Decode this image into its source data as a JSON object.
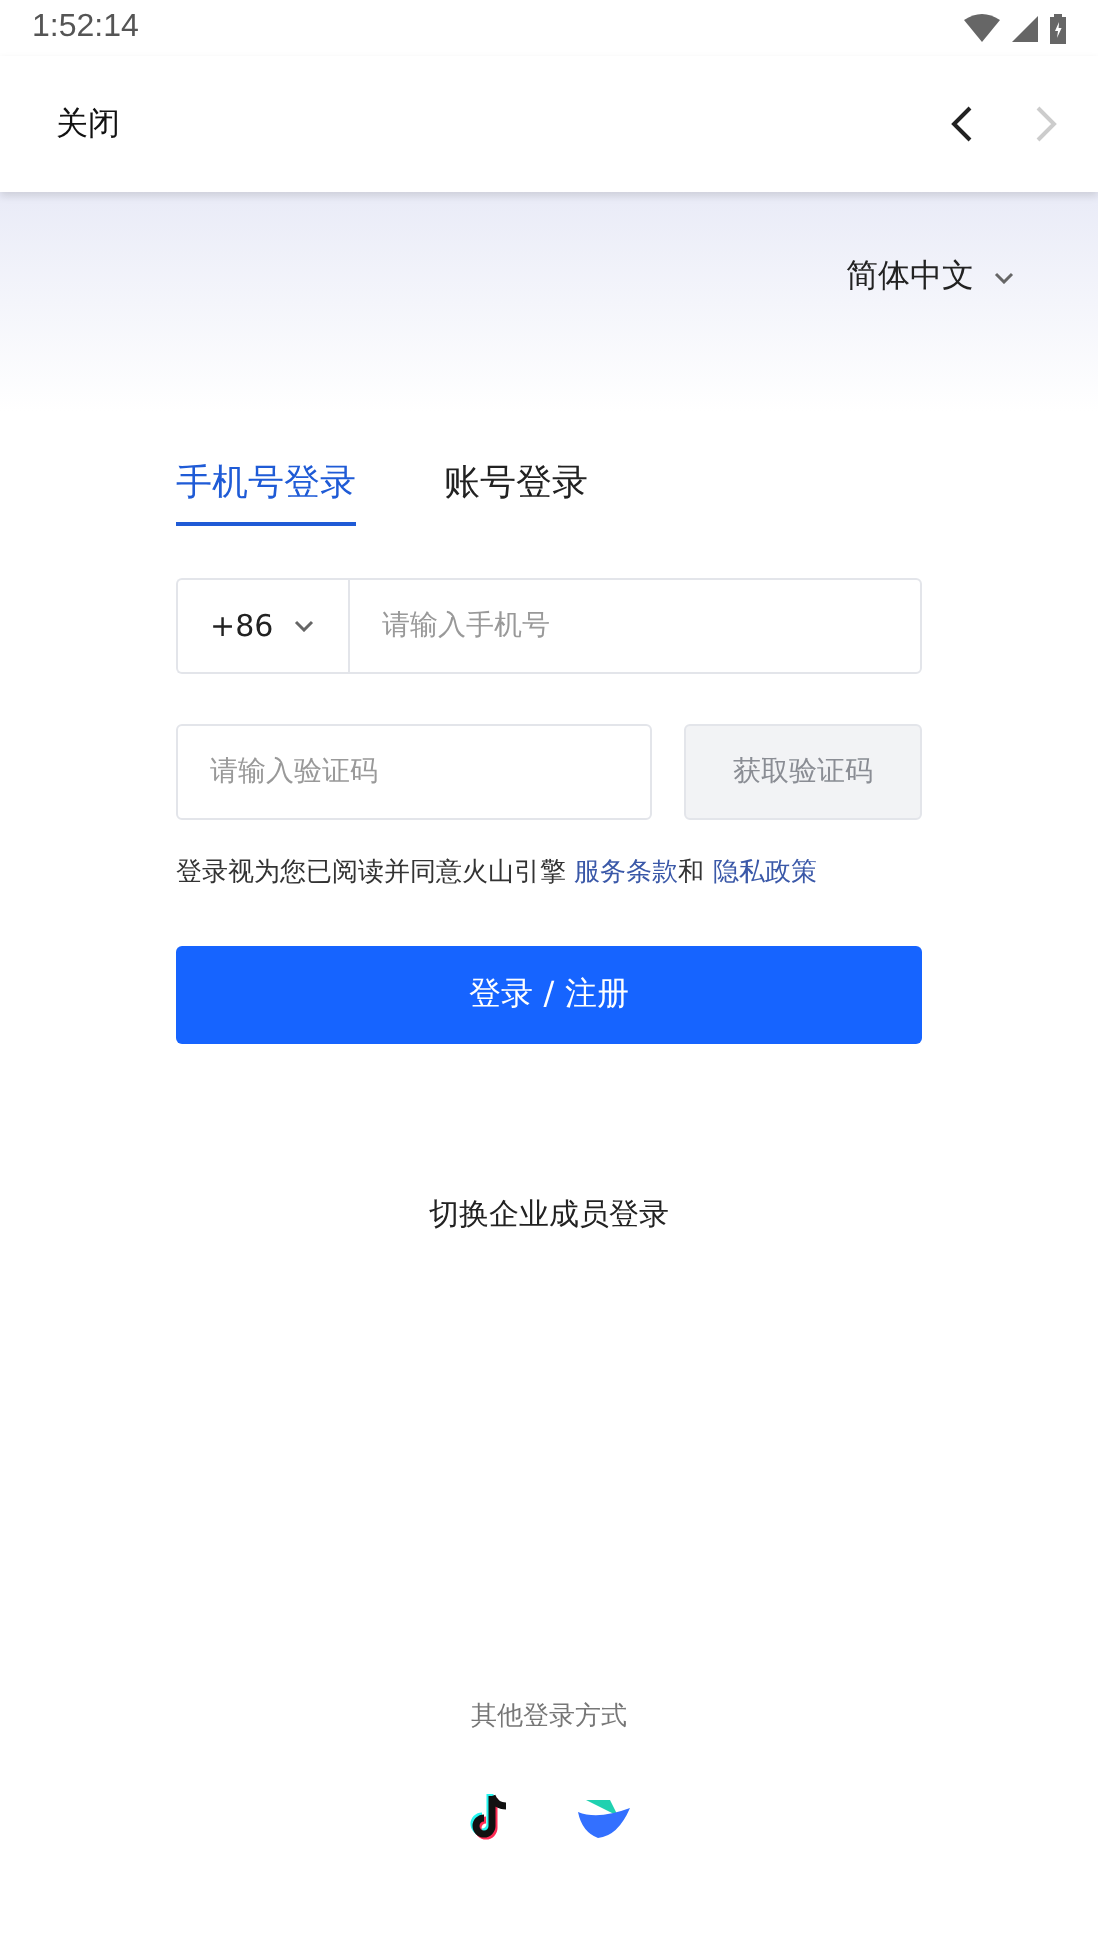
{
  "status_bar": {
    "time": "1:52:14"
  },
  "header": {
    "close": "关闭",
    "back_disabled": false,
    "forward_disabled": true
  },
  "language": "简体中文",
  "tabs": [
    {
      "label": "手机号登录",
      "selected": true
    },
    {
      "label": "账号登录",
      "selected": false
    }
  ],
  "phone": {
    "country_code": "+86",
    "placeholder": "请输入手机号"
  },
  "code": {
    "placeholder": "请输入验证码",
    "button": "获取验证码",
    "button_disabled": true
  },
  "terms": {
    "text": "登录视为您已阅读并同意火山引擎",
    "link_1": "服务条款",
    "joiner": "和",
    "link_2": "隐私政策"
  },
  "submit": "登录 / 注册",
  "switch_link": "切换企业成员登录",
  "other_login": {
    "label": "其他登录方式",
    "icons": [
      {
        "kind": "note"
      },
      {
        "kind": "fold"
      }
    ]
  }
}
